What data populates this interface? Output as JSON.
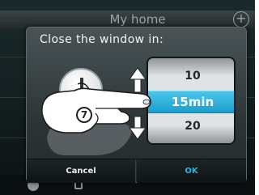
{
  "background": {
    "title": "My home",
    "plus_icon": "+"
  },
  "dialog": {
    "title": "Close the window in:",
    "picker": {
      "above": "10",
      "selected": "15min",
      "below": "20"
    },
    "cancel_label": "Cancel",
    "ok_label": "OK"
  },
  "gesture": {
    "step_number": "7",
    "hand_icon": "hand-pointer-icon",
    "arrow_icon": "up-down-arrow-icon"
  },
  "colors": {
    "accent": "#28b3e6",
    "selected_band": "#1a9fd0"
  }
}
